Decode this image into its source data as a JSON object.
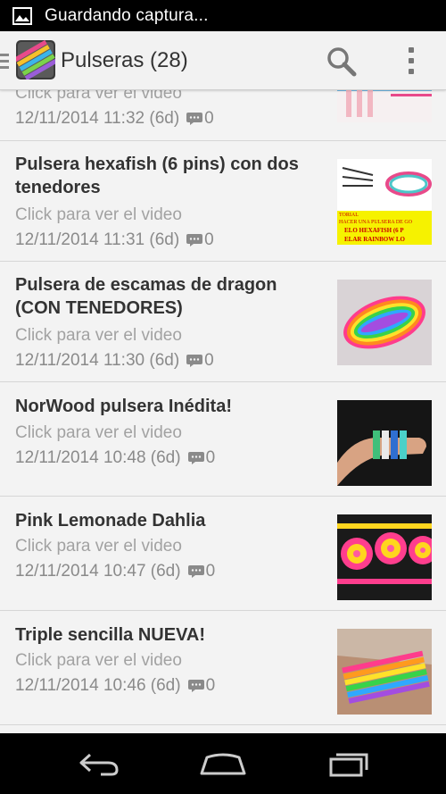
{
  "status_bar": {
    "text": "Guardando captura..."
  },
  "action_bar": {
    "title": "Pulseras (28)",
    "icons": [
      "app-logo",
      "search-icon",
      "overflow-menu-icon"
    ]
  },
  "list": {
    "items": [
      {
        "title": "",
        "subtitle": "Click para ver el video",
        "date": "12/11/2014 11:32 (6d)",
        "comments": "0"
      },
      {
        "title": "Pulsera hexafish (6 pins) con dos tenedores",
        "subtitle": "Click para ver el video",
        "date": "12/11/2014 11:31 (6d)",
        "comments": "0",
        "thumb_text": [
          "TORIAL",
          "HACER UNA PULSERA DE GO",
          "ELO HEXAFISH (6 P",
          "ELAR RAINBOW LO"
        ]
      },
      {
        "title": "Pulsera de escamas de dragon (CON TENEDORES)",
        "subtitle": "Click para ver el video",
        "date": "12/11/2014 11:30 (6d)",
        "comments": "0"
      },
      {
        "title": "NorWood pulsera Inédita!",
        "subtitle": "Click para ver el video",
        "date": "12/11/2014 10:48 (6d)",
        "comments": "0"
      },
      {
        "title": "Pink Lemonade Dahlia",
        "subtitle": "Click para ver el video",
        "date": "12/11/2014 10:47 (6d)",
        "comments": "0"
      },
      {
        "title": "Triple sencilla NUEVA!",
        "subtitle": "Click para ver el video",
        "date": "12/11/2014 10:46 (6d)",
        "comments": "0"
      }
    ]
  },
  "nav_bar": {
    "icons": [
      "back-icon",
      "home-icon",
      "recent-apps-icon"
    ]
  }
}
